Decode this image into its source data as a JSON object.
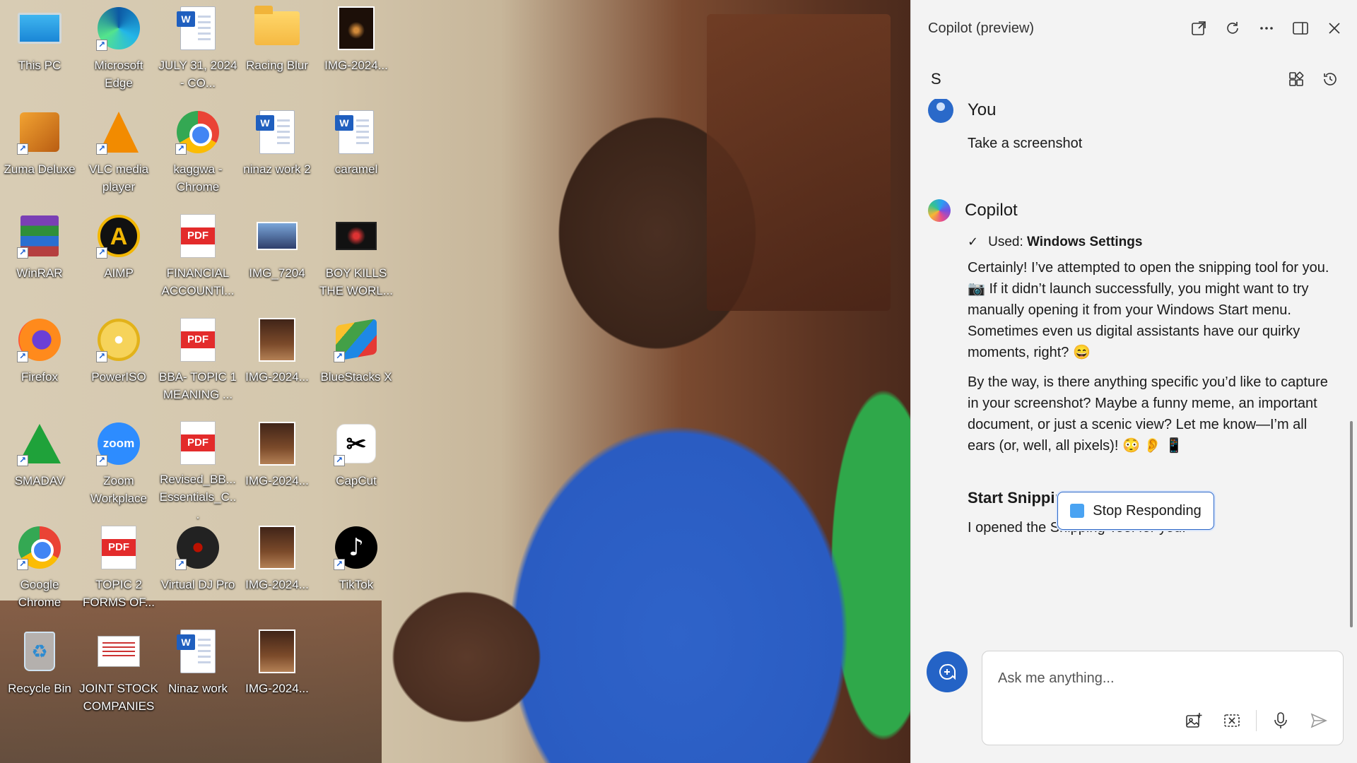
{
  "desktop": {
    "icons": [
      {
        "label": "This PC",
        "icon": "monitor-icon"
      },
      {
        "label": "Microsoft Edge",
        "icon": "edge-icon"
      },
      {
        "label": "JULY 31, 2024 - CO...",
        "icon": "word-doc-icon"
      },
      {
        "label": "Racing Blur",
        "icon": "folder-icon"
      },
      {
        "label": "IMG-2024...",
        "icon": "photo-icon"
      },
      {
        "label": "Zuma Deluxe",
        "icon": "zuma-icon"
      },
      {
        "label": "VLC media player",
        "icon": "vlc-icon"
      },
      {
        "label": "kaggwa - Chrome",
        "icon": "chrome-profile-icon"
      },
      {
        "label": "ninaz work 2",
        "icon": "word-doc-icon"
      },
      {
        "label": "caramel",
        "icon": "word-doc-icon"
      },
      {
        "label": "WinRAR",
        "icon": "winrar-icon"
      },
      {
        "label": "AIMP",
        "icon": "aimp-icon"
      },
      {
        "label": "FINANCIAL ACCOUNTI...",
        "icon": "pdf-icon"
      },
      {
        "label": "IMG_7204",
        "icon": "photo-icon"
      },
      {
        "label": "BOY KILLS THE WORL...",
        "icon": "video-icon"
      },
      {
        "label": "Firefox",
        "icon": "firefox-icon"
      },
      {
        "label": "PowerISO",
        "icon": "poweriso-icon"
      },
      {
        "label": "BBA- TOPIC 1 MEANING ...",
        "icon": "pdf-icon"
      },
      {
        "label": "IMG-2024...",
        "icon": "photo-icon"
      },
      {
        "label": "BlueStacks X",
        "icon": "bluestacks-icon"
      },
      {
        "label": "SMADAV",
        "icon": "smadav-icon"
      },
      {
        "label": "Zoom Workplace",
        "icon": "zoom-icon"
      },
      {
        "label": "Revised_BB... Essentials_C...",
        "icon": "pdf-icon"
      },
      {
        "label": "IMG-2024...",
        "icon": "photo-icon"
      },
      {
        "label": "CapCut",
        "icon": "capcut-icon"
      },
      {
        "label": "Google Chrome",
        "icon": "chrome-icon"
      },
      {
        "label": "TOPIC 2 FORMS OF...",
        "icon": "pdf-icon"
      },
      {
        "label": "Virtual DJ Pro",
        "icon": "virtualdj-icon"
      },
      {
        "label": "IMG-2024...",
        "icon": "photo-icon"
      },
      {
        "label": "TikTok",
        "icon": "tiktok-icon"
      },
      {
        "label": "Recycle Bin",
        "icon": "recycle-bin-icon"
      },
      {
        "label": "JOINT STOCK COMPANIES",
        "icon": "document-thumbnail-icon"
      },
      {
        "label": "Ninaz work",
        "icon": "word-doc-icon"
      },
      {
        "label": "IMG-2024...",
        "icon": "photo-icon"
      }
    ],
    "zoom_logo_text": "zoom",
    "pdf_badge": "PDF",
    "word_badge": "W"
  },
  "copilot": {
    "title": "Copilot (preview)",
    "user_initial": "S",
    "user_name": "You",
    "user_message": "Take a screenshot",
    "assistant_name": "Copilot",
    "used_prefix": "Used:",
    "used_plugin": "Windows Settings",
    "paragraph1": "Certainly! I’ve attempted to open the snipping tool for you. 📷 If it didn’t launch successfully, you might want to try manually opening it from your Windows Start menu. Sometimes even us digital assistants have our quirky moments, right? 😄",
    "paragraph2": "By the way, is there anything specific you’d like to capture in your screenshot? Maybe a funny meme, an important document, or just a scenic view? Let me know—I’m all ears (or, well, all pixels)! 😳 👂 📱",
    "action_title": "Start Snipping Tool",
    "action_text": "I opened the Snipping Tool for you.",
    "stop_label": "Stop Responding",
    "input_placeholder": "Ask me anything...",
    "accent_color": "#2463c6"
  }
}
